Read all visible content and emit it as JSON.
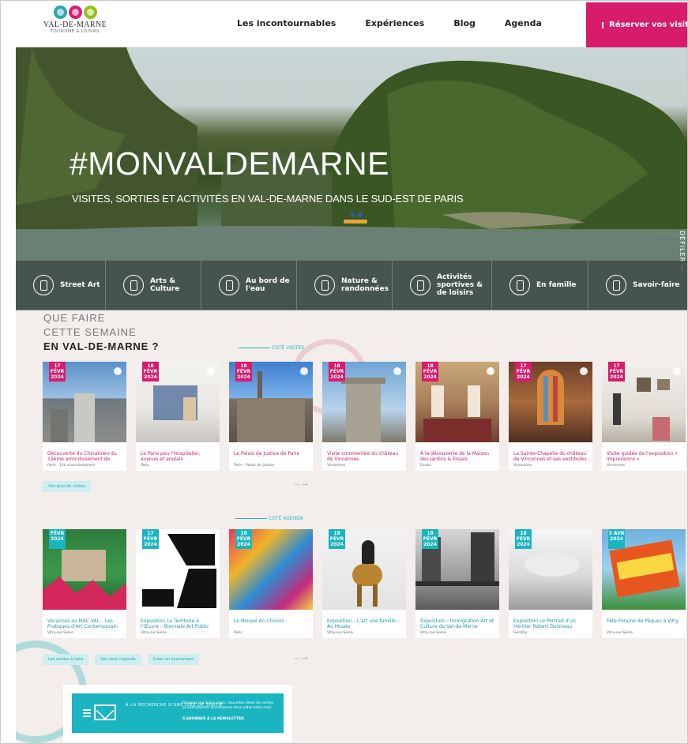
{
  "header": {
    "logo_line1": "VAL-DE-MARNE",
    "logo_line2": "TOURISME & LOISIRS",
    "nav": [
      "Les incontournables",
      "Expériences",
      "Blog",
      "Agenda"
    ],
    "book_label": "Réserver vos visites"
  },
  "hero": {
    "title": "#MONVALDEMARNE",
    "subtitle": "VISITES, SORTIES ET ACTIVITÉS EN VAL-DE-MARNE DANS LE SUD-EST DE PARIS",
    "scroll_label": "DÉFILER —"
  },
  "categories": [
    "Street Art",
    "Arts & Culture",
    "Au bord de l'eau",
    "Nature & randonnées",
    "Activités sportives & de loisirs",
    "En famille",
    "Savoir-faire"
  ],
  "section": {
    "line1": "QUE FAIRE",
    "line2": "CETTE SEMAINE",
    "line3": "EN VAL-DE-MARNE ?"
  },
  "colors": {
    "pink": "#d91b6c",
    "teal": "#1ab5c1",
    "bg": "#f3eeec"
  },
  "row1": {
    "label": "COTÉ VISITES",
    "cards": [
      {
        "badge": "17 FÉVR 2024",
        "title": "Découverte du Chinatown du 13ème arrondissement de Paris",
        "meta": "Paris · 13e arrondissement"
      },
      {
        "badge": "18 FÉVR 2024",
        "title": "Le Paris peu l'Hospitalier, avenue et anglais",
        "meta": "Paris"
      },
      {
        "badge": "18 FÉVR 2024",
        "title": "Le Palais de Justice de Paris",
        "meta": "Paris · Palais de Justice"
      },
      {
        "badge": "18 FÉVR 2024",
        "title": "Visite commentée du château de Vincennes",
        "meta": "Vincennes"
      },
      {
        "badge": "18 FÉVR 2024",
        "title": "À la découverte de la Maison des Jardins & Essais",
        "meta": "Essais"
      },
      {
        "badge": "17 FÉVR 2024",
        "title": "La Sainte-Chapelle du château de Vincennes et ses vestibules",
        "meta": "Vincennes"
      },
      {
        "badge": "17 FÉVR 2024",
        "title": "Visite guidée de l'exposition « Impressions »",
        "meta": "Vincennes"
      }
    ],
    "button": "Voir plus de visites"
  },
  "row2": {
    "label": "COTÉ AGENDA",
    "cards": [
      {
        "badge": "FÉVR 2024",
        "title": "Vacances au MAC VAL – Les Pratiques d'Art Contemporain",
        "meta": "Vitry-sur-Seine"
      },
      {
        "badge": "17 FÉVR 2024",
        "title": "Exposition Le Territoire à l'Œuvre – Biennale Art Public",
        "meta": "Vitry-sur-Seine"
      },
      {
        "badge": "18 FÉVR 2024",
        "title": "Le Nouvel An Chinois",
        "meta": "Paris"
      },
      {
        "badge": "18 FÉVR 2024",
        "title": "Exposition – L'art une famille – Au Musée",
        "meta": "Vitry-sur-Seine"
      },
      {
        "badge": "18 FÉVR 2024",
        "title": "Exposition – Immigration Art et Culture du Val-de-Marne",
        "meta": "Vitry-sur-Seine"
      },
      {
        "badge": "18 FÉVR 2024",
        "title": "Exposition Le Portrait d'un Héritier Robert Doisneau",
        "meta": "Gentilly"
      },
      {
        "badge": "3 AVR 2024",
        "title": "Fête Foraine de Pâques à Vitry",
        "meta": "Vitry-sur-Seine"
      }
    ],
    "buttons": [
      "Les sorties à faire",
      "Voir tout l'agenda",
      "Créer un événement"
    ]
  },
  "newsletter": {
    "title": "À LA RECHERCHE D'UNE IDÉE DE SORTIE",
    "desc": "Recevez nos bons plans, nouvelles idées de sorties et événements directement dans votre boîte mail.",
    "cta": "S'ABONNER À LA NEWSLETTER"
  }
}
